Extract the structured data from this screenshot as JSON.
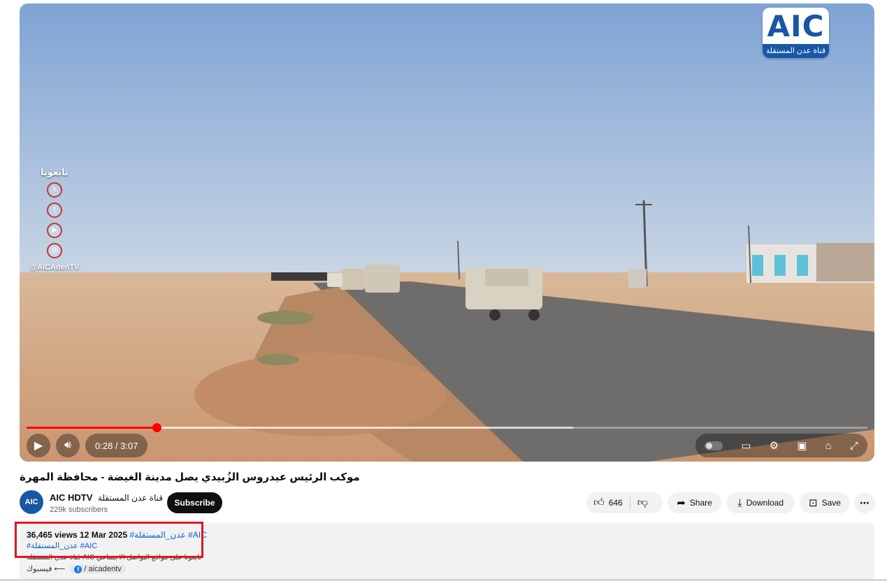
{
  "player": {
    "logo_text": "AIC",
    "logo_subtitle": "قناة عدن المستقلة",
    "follow_title": "تابعونا",
    "follow_icons": [
      "x-icon",
      "facebook-icon",
      "youtube-icon",
      "instagram-icon"
    ],
    "follow_handle": "@AICAdenTV",
    "time": "0:28 / 3:07",
    "progress_played_fraction": 0.155,
    "progress_buffered_fraction": 0.65,
    "accent_color": "#ff0000"
  },
  "video": {
    "title": "موكب الرئيس عيدروس الزُبيدي يصل مدينة الغيضة - محافظة المهرة"
  },
  "channel": {
    "avatar_text": "AIC",
    "name": "AIC HDTV",
    "name_alt": "قناة عدن المستقلة",
    "subscribers": "229k subscribers",
    "subscribe_label": "Subscribe"
  },
  "actions": {
    "likes": "646",
    "share_label": "Share",
    "download_label": "Download",
    "save_label": "Save"
  },
  "description": {
    "stats": "36,465 views  12 Mar 2025",
    "tags_line1": "#عدن_المستقلة #AIC",
    "tags_line2": "#عدن_المستقلة #AIC",
    "truncated_line": "تابعونا على مواقع التواصل الاجتماعي AIC قناة عدن المستقلة",
    "link_label": "فيسبوك ⟵",
    "link_handle": "/ aicadentv"
  }
}
